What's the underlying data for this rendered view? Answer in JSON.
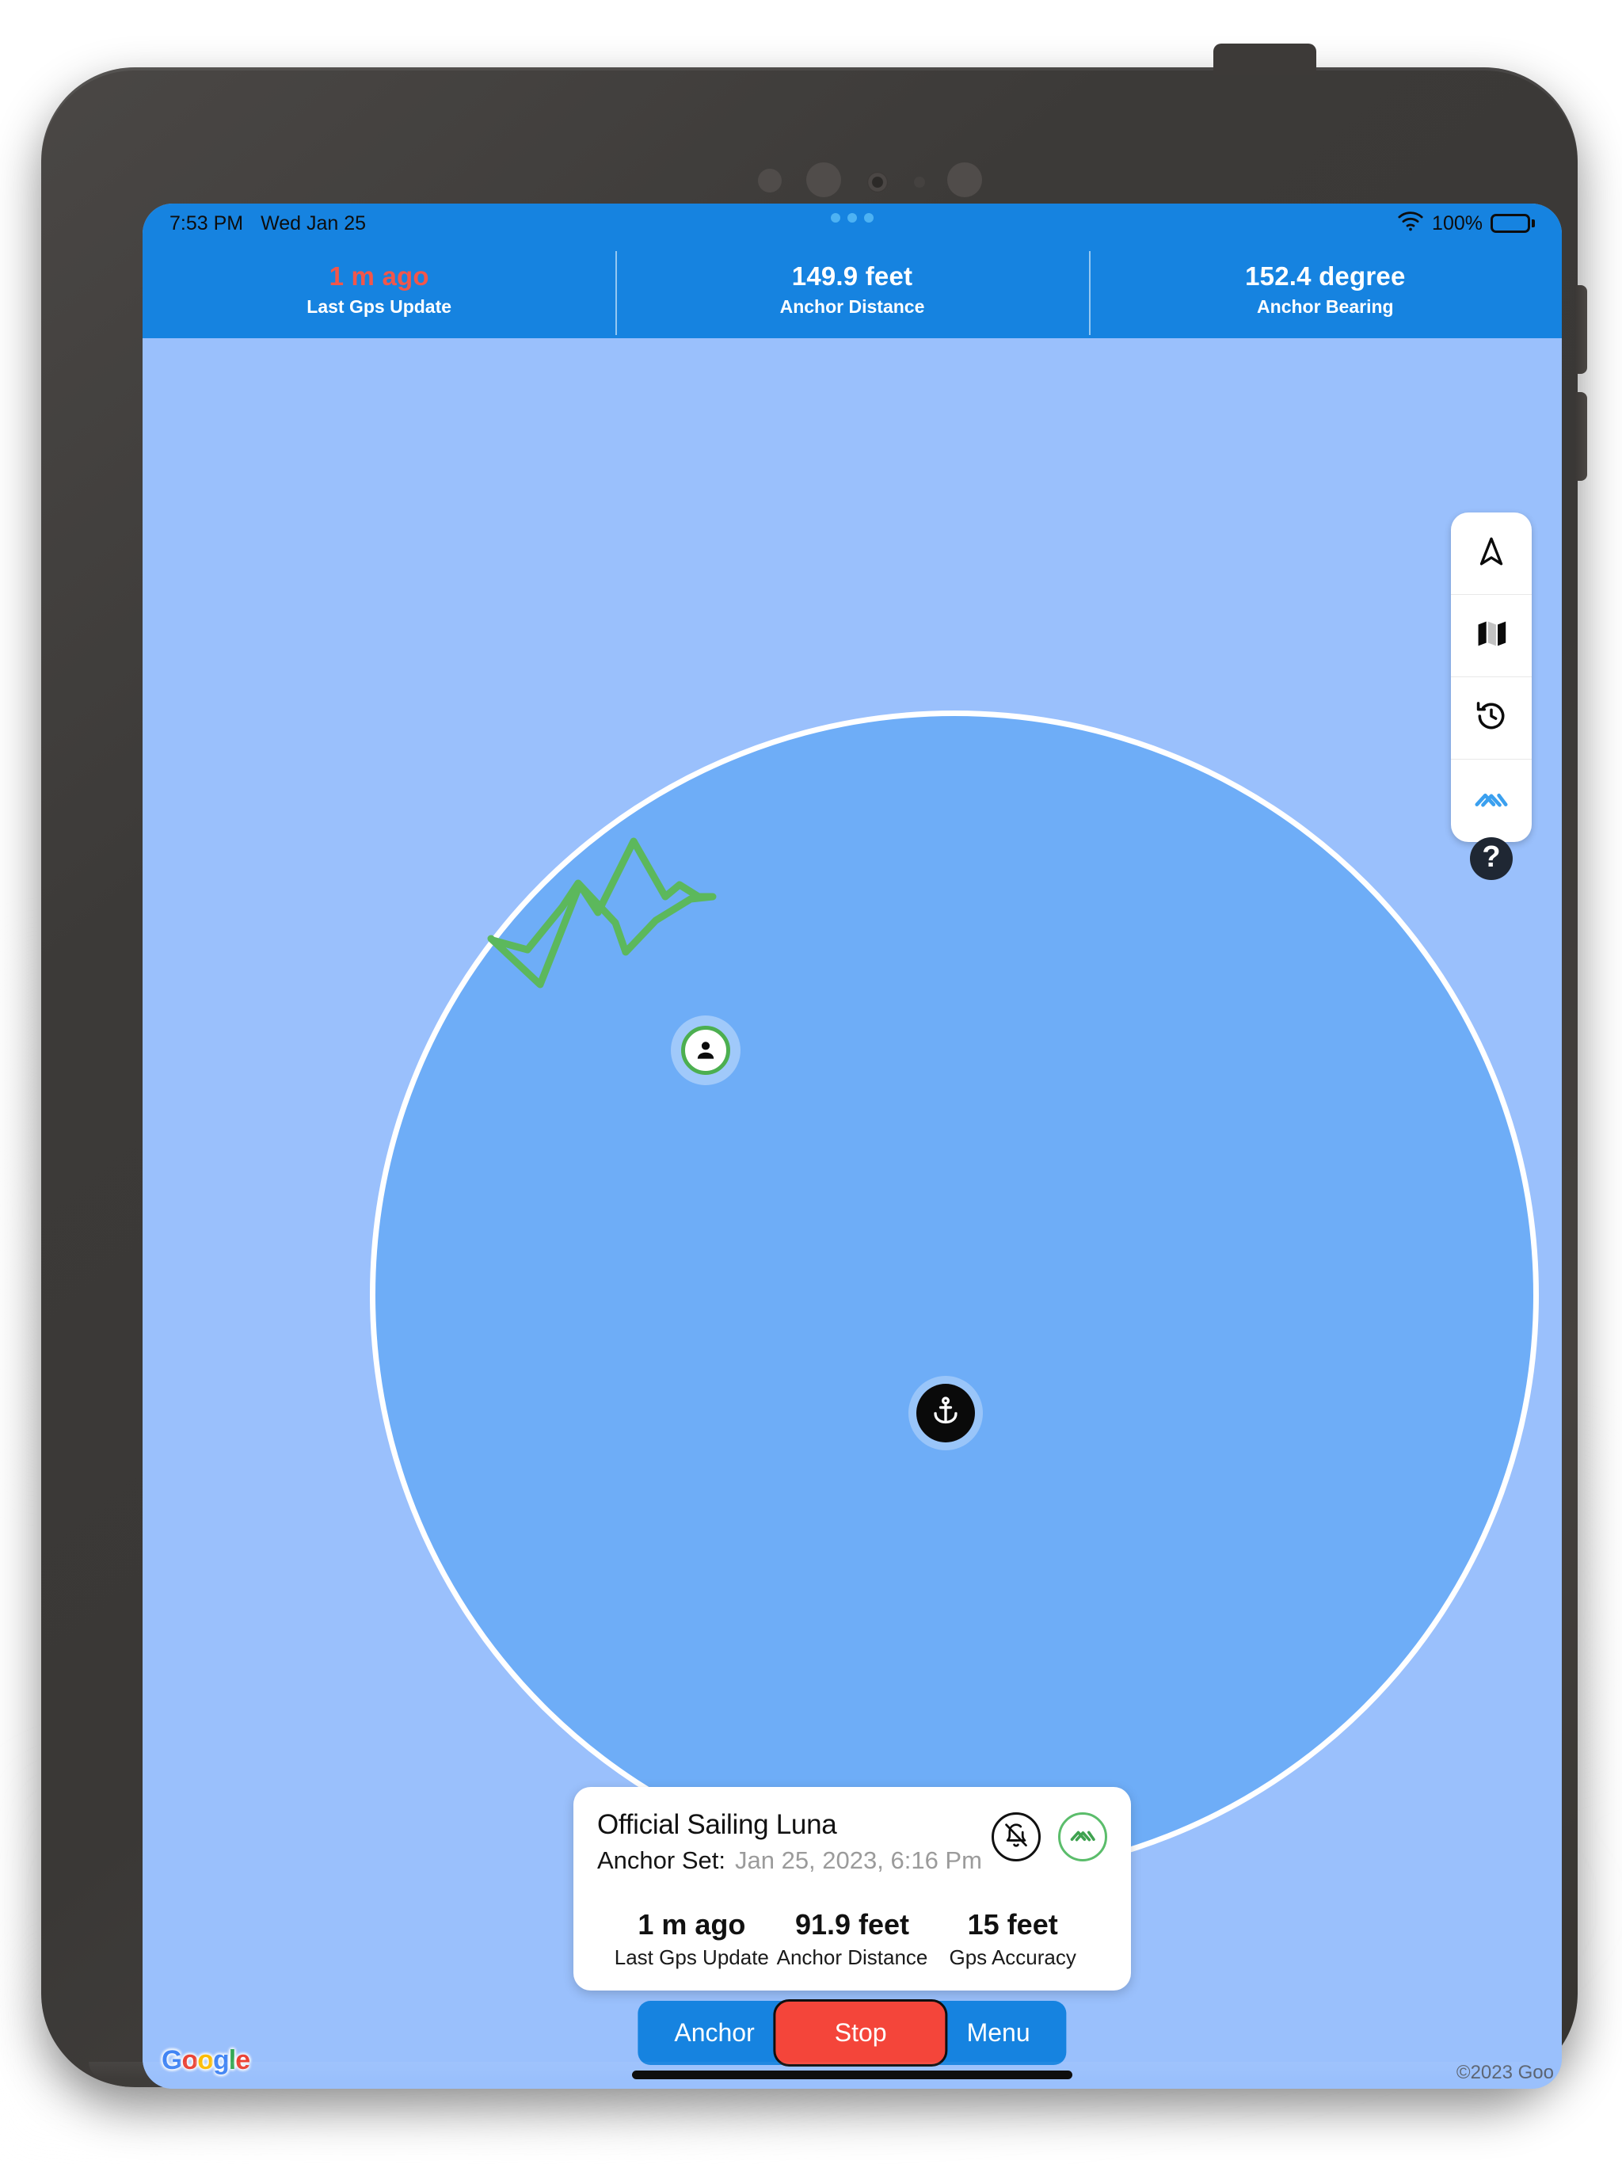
{
  "status_bar": {
    "time": "7:53 PM",
    "date": "Wed Jan 25",
    "battery_percent": "100%",
    "wifi_icon": "wifi-icon",
    "battery_icon": "battery-full-icon"
  },
  "topbar": {
    "metrics": [
      {
        "value": "1 m ago",
        "label": "Last Gps Update",
        "alert": true
      },
      {
        "value": "149.9 feet",
        "label": "Anchor Distance",
        "alert": false
      },
      {
        "value": "152.4 degree",
        "label": "Anchor Bearing",
        "alert": false
      }
    ]
  },
  "map_controls": [
    {
      "name": "navigation-arrow-icon",
      "label": "Center on vessel"
    },
    {
      "name": "map-layers-icon",
      "label": "Map type"
    },
    {
      "name": "history-clock-icon",
      "label": "Track history"
    },
    {
      "name": "anchor-watch-icon",
      "label": "Anchor alarm",
      "active": true
    }
  ],
  "help_button": {
    "label": "?",
    "icon": "help-question-icon"
  },
  "map": {
    "anchor_marker_icon": "anchor-icon",
    "vessel_marker_icon": "person-location-icon",
    "circle_stroke_color": "#ffffff",
    "circle_fill_color": "#6eadf7",
    "background_color": "#9ac0fc",
    "track_color": "#5cb85c",
    "attribution": "©2023 Goo",
    "logo_letters": [
      "G",
      "o",
      "o",
      "g",
      "l",
      "e"
    ]
  },
  "info_card": {
    "title": "Official Sailing Luna",
    "anchor_set_label": "Anchor Set:",
    "anchor_set_value": "Jan 25, 2023, 6:16 Pm",
    "actions": [
      {
        "name": "bell-off-icon",
        "state": "muted"
      },
      {
        "name": "anchor-watch-icon",
        "state": "active",
        "color": "#5bbd6b"
      }
    ],
    "metrics": [
      {
        "value": "1 m ago",
        "label": "Last Gps Update"
      },
      {
        "value": "91.9 feet",
        "label": "Anchor Distance"
      },
      {
        "value": "15 feet",
        "label": "Gps Accuracy"
      }
    ]
  },
  "action_bar": {
    "anchor_label": "Anchor",
    "stop_label": "Stop",
    "menu_label": "Menu",
    "stop_color": "#f4453a",
    "blue_color": "#1683e0"
  }
}
